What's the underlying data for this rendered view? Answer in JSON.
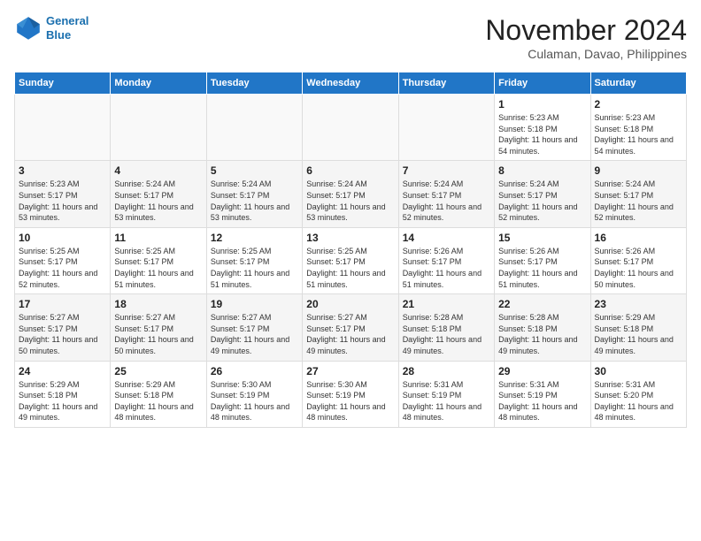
{
  "header": {
    "logo_line1": "General",
    "logo_line2": "Blue",
    "month_year": "November 2024",
    "location": "Culaman, Davao, Philippines"
  },
  "days_of_week": [
    "Sunday",
    "Monday",
    "Tuesday",
    "Wednesday",
    "Thursday",
    "Friday",
    "Saturday"
  ],
  "weeks": [
    [
      {
        "day": "",
        "sunrise": "",
        "sunset": "",
        "daylight": ""
      },
      {
        "day": "",
        "sunrise": "",
        "sunset": "",
        "daylight": ""
      },
      {
        "day": "",
        "sunrise": "",
        "sunset": "",
        "daylight": ""
      },
      {
        "day": "",
        "sunrise": "",
        "sunset": "",
        "daylight": ""
      },
      {
        "day": "",
        "sunrise": "",
        "sunset": "",
        "daylight": ""
      },
      {
        "day": "1",
        "sunrise": "Sunrise: 5:23 AM",
        "sunset": "Sunset: 5:18 PM",
        "daylight": "Daylight: 11 hours and 54 minutes."
      },
      {
        "day": "2",
        "sunrise": "Sunrise: 5:23 AM",
        "sunset": "Sunset: 5:18 PM",
        "daylight": "Daylight: 11 hours and 54 minutes."
      }
    ],
    [
      {
        "day": "3",
        "sunrise": "Sunrise: 5:23 AM",
        "sunset": "Sunset: 5:17 PM",
        "daylight": "Daylight: 11 hours and 53 minutes."
      },
      {
        "day": "4",
        "sunrise": "Sunrise: 5:24 AM",
        "sunset": "Sunset: 5:17 PM",
        "daylight": "Daylight: 11 hours and 53 minutes."
      },
      {
        "day": "5",
        "sunrise": "Sunrise: 5:24 AM",
        "sunset": "Sunset: 5:17 PM",
        "daylight": "Daylight: 11 hours and 53 minutes."
      },
      {
        "day": "6",
        "sunrise": "Sunrise: 5:24 AM",
        "sunset": "Sunset: 5:17 PM",
        "daylight": "Daylight: 11 hours and 53 minutes."
      },
      {
        "day": "7",
        "sunrise": "Sunrise: 5:24 AM",
        "sunset": "Sunset: 5:17 PM",
        "daylight": "Daylight: 11 hours and 52 minutes."
      },
      {
        "day": "8",
        "sunrise": "Sunrise: 5:24 AM",
        "sunset": "Sunset: 5:17 PM",
        "daylight": "Daylight: 11 hours and 52 minutes."
      },
      {
        "day": "9",
        "sunrise": "Sunrise: 5:24 AM",
        "sunset": "Sunset: 5:17 PM",
        "daylight": "Daylight: 11 hours and 52 minutes."
      }
    ],
    [
      {
        "day": "10",
        "sunrise": "Sunrise: 5:25 AM",
        "sunset": "Sunset: 5:17 PM",
        "daylight": "Daylight: 11 hours and 52 minutes."
      },
      {
        "day": "11",
        "sunrise": "Sunrise: 5:25 AM",
        "sunset": "Sunset: 5:17 PM",
        "daylight": "Daylight: 11 hours and 51 minutes."
      },
      {
        "day": "12",
        "sunrise": "Sunrise: 5:25 AM",
        "sunset": "Sunset: 5:17 PM",
        "daylight": "Daylight: 11 hours and 51 minutes."
      },
      {
        "day": "13",
        "sunrise": "Sunrise: 5:25 AM",
        "sunset": "Sunset: 5:17 PM",
        "daylight": "Daylight: 11 hours and 51 minutes."
      },
      {
        "day": "14",
        "sunrise": "Sunrise: 5:26 AM",
        "sunset": "Sunset: 5:17 PM",
        "daylight": "Daylight: 11 hours and 51 minutes."
      },
      {
        "day": "15",
        "sunrise": "Sunrise: 5:26 AM",
        "sunset": "Sunset: 5:17 PM",
        "daylight": "Daylight: 11 hours and 51 minutes."
      },
      {
        "day": "16",
        "sunrise": "Sunrise: 5:26 AM",
        "sunset": "Sunset: 5:17 PM",
        "daylight": "Daylight: 11 hours and 50 minutes."
      }
    ],
    [
      {
        "day": "17",
        "sunrise": "Sunrise: 5:27 AM",
        "sunset": "Sunset: 5:17 PM",
        "daylight": "Daylight: 11 hours and 50 minutes."
      },
      {
        "day": "18",
        "sunrise": "Sunrise: 5:27 AM",
        "sunset": "Sunset: 5:17 PM",
        "daylight": "Daylight: 11 hours and 50 minutes."
      },
      {
        "day": "19",
        "sunrise": "Sunrise: 5:27 AM",
        "sunset": "Sunset: 5:17 PM",
        "daylight": "Daylight: 11 hours and 49 minutes."
      },
      {
        "day": "20",
        "sunrise": "Sunrise: 5:27 AM",
        "sunset": "Sunset: 5:17 PM",
        "daylight": "Daylight: 11 hours and 49 minutes."
      },
      {
        "day": "21",
        "sunrise": "Sunrise: 5:28 AM",
        "sunset": "Sunset: 5:18 PM",
        "daylight": "Daylight: 11 hours and 49 minutes."
      },
      {
        "day": "22",
        "sunrise": "Sunrise: 5:28 AM",
        "sunset": "Sunset: 5:18 PM",
        "daylight": "Daylight: 11 hours and 49 minutes."
      },
      {
        "day": "23",
        "sunrise": "Sunrise: 5:29 AM",
        "sunset": "Sunset: 5:18 PM",
        "daylight": "Daylight: 11 hours and 49 minutes."
      }
    ],
    [
      {
        "day": "24",
        "sunrise": "Sunrise: 5:29 AM",
        "sunset": "Sunset: 5:18 PM",
        "daylight": "Daylight: 11 hours and 49 minutes."
      },
      {
        "day": "25",
        "sunrise": "Sunrise: 5:29 AM",
        "sunset": "Sunset: 5:18 PM",
        "daylight": "Daylight: 11 hours and 48 minutes."
      },
      {
        "day": "26",
        "sunrise": "Sunrise: 5:30 AM",
        "sunset": "Sunset: 5:19 PM",
        "daylight": "Daylight: 11 hours and 48 minutes."
      },
      {
        "day": "27",
        "sunrise": "Sunrise: 5:30 AM",
        "sunset": "Sunset: 5:19 PM",
        "daylight": "Daylight: 11 hours and 48 minutes."
      },
      {
        "day": "28",
        "sunrise": "Sunrise: 5:31 AM",
        "sunset": "Sunset: 5:19 PM",
        "daylight": "Daylight: 11 hours and 48 minutes."
      },
      {
        "day": "29",
        "sunrise": "Sunrise: 5:31 AM",
        "sunset": "Sunset: 5:19 PM",
        "daylight": "Daylight: 11 hours and 48 minutes."
      },
      {
        "day": "30",
        "sunrise": "Sunrise: 5:31 AM",
        "sunset": "Sunset: 5:20 PM",
        "daylight": "Daylight: 11 hours and 48 minutes."
      }
    ]
  ]
}
